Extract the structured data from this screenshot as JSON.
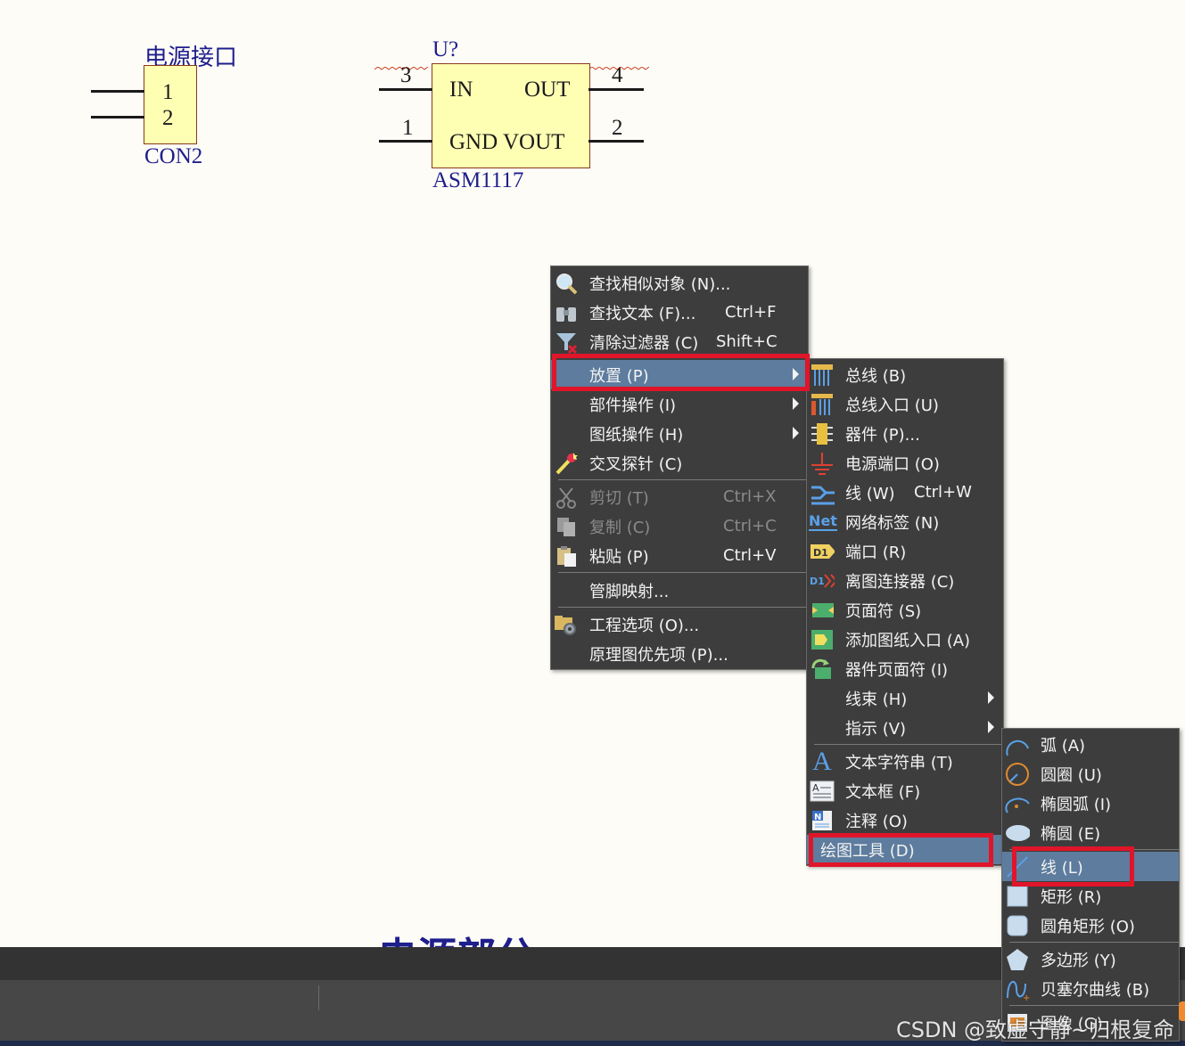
{
  "schematic": {
    "con_title": "电源接口",
    "con_pins": [
      "1",
      "2"
    ],
    "con_name": "CON2",
    "u_designator": "U?",
    "u_pin_in_num": "3",
    "u_pin_out_num": "4",
    "u_pin_gnd_num": "1",
    "u_pin_vout_num": "2",
    "u_label_in": "IN",
    "u_label_out": "OUT",
    "u_label_gnd_vout": "GND VOUT",
    "u_name": "ASM1117",
    "section_title": "电源部分"
  },
  "context_menu": {
    "items": [
      {
        "label": "查找相似对象 (N)...",
        "shortcut": "",
        "icon": "search-icon"
      },
      {
        "label": "查找文本 (F)...",
        "shortcut": "Ctrl+F",
        "icon": "binoculars-icon"
      },
      {
        "label": "清除过滤器 (C)",
        "shortcut": "Shift+C",
        "icon": "filter-clear-icon"
      },
      {
        "label": "放置 (P)",
        "shortcut": "",
        "icon": ""
      },
      {
        "label": "部件操作 (I)",
        "shortcut": "",
        "icon": ""
      },
      {
        "label": "图纸操作 (H)",
        "shortcut": "",
        "icon": ""
      },
      {
        "label": "交叉探针 (C)",
        "shortcut": "",
        "icon": "cross-probe-icon"
      },
      {
        "label": "剪切 (T)",
        "shortcut": "Ctrl+X",
        "icon": "scissors-icon"
      },
      {
        "label": "复制 (C)",
        "shortcut": "Ctrl+C",
        "icon": "copy-icon"
      },
      {
        "label": "粘贴 (P)",
        "shortcut": "Ctrl+V",
        "icon": "paste-icon"
      },
      {
        "label": "管脚映射...",
        "shortcut": "",
        "icon": ""
      },
      {
        "label": "工程选项 (O)...",
        "shortcut": "",
        "icon": "project-options-icon"
      },
      {
        "label": "原理图优先项 (P)...",
        "shortcut": "",
        "icon": ""
      }
    ]
  },
  "place_menu": {
    "items": [
      {
        "label": "总线 (B)",
        "shortcut": "",
        "icon": "bus-icon"
      },
      {
        "label": "总线入口 (U)",
        "shortcut": "",
        "icon": "bus-entry-icon"
      },
      {
        "label": "器件 (P)...",
        "shortcut": "",
        "icon": "component-icon"
      },
      {
        "label": "电源端口 (O)",
        "shortcut": "",
        "icon": "power-port-icon"
      },
      {
        "label": "线 (W)",
        "shortcut": "Ctrl+W",
        "icon": "wire-icon"
      },
      {
        "label": "网络标签 (N)",
        "shortcut": "",
        "icon": "net-label-icon"
      },
      {
        "label": "端口 (R)",
        "shortcut": "",
        "icon": "port-icon"
      },
      {
        "label": "离图连接器 (C)",
        "shortcut": "",
        "icon": "off-sheet-connector-icon"
      },
      {
        "label": "页面符 (S)",
        "shortcut": "",
        "icon": "sheet-symbol-icon"
      },
      {
        "label": "添加图纸入口 (A)",
        "shortcut": "",
        "icon": "sheet-entry-icon"
      },
      {
        "label": "器件页面符 (I)",
        "shortcut": "",
        "icon": "device-sheet-symbol-icon"
      },
      {
        "label": "线束 (H)",
        "shortcut": "",
        "icon": ""
      },
      {
        "label": "指示 (V)",
        "shortcut": "",
        "icon": ""
      },
      {
        "label": "文本字符串 (T)",
        "shortcut": "",
        "icon": "text-string-icon"
      },
      {
        "label": "文本框 (F)",
        "shortcut": "",
        "icon": "text-frame-icon"
      },
      {
        "label": "注释 (O)",
        "shortcut": "",
        "icon": "note-icon"
      },
      {
        "label": "绘图工具 (D)",
        "shortcut": "",
        "icon": ""
      }
    ]
  },
  "drawing_menu": {
    "items": [
      {
        "label": "弧 (A)",
        "icon": "arc-icon"
      },
      {
        "label": "圆圈 (U)",
        "icon": "circle-icon"
      },
      {
        "label": "椭圆弧 (I)",
        "icon": "elliptical-arc-icon"
      },
      {
        "label": "椭圆 (E)",
        "icon": "ellipse-icon"
      },
      {
        "label": "线 (L)",
        "icon": "line-icon"
      },
      {
        "label": "矩形 (R)",
        "icon": "rectangle-icon"
      },
      {
        "label": "圆角矩形 (O)",
        "icon": "round-rectangle-icon"
      },
      {
        "label": "多边形 (Y)",
        "icon": "polygon-icon"
      },
      {
        "label": "贝塞尔曲线 (B)",
        "icon": "bezier-icon"
      },
      {
        "label": "图像 (G)",
        "icon": "image-icon"
      }
    ]
  },
  "watermark": "CSDN @致虚守静~归根复命",
  "colors": {
    "canvas": "#fdfcf7",
    "menu_bg": "#3d3d3d",
    "highlight": "#5d7c9e",
    "red_annotation": "#e0152a",
    "component_fill": "#ffffb4",
    "text_blue": "#1e1e8c"
  }
}
